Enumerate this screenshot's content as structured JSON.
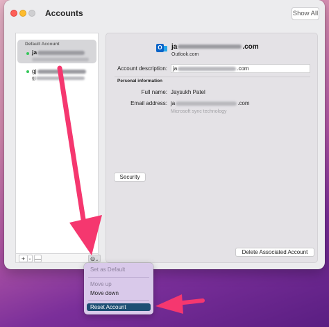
{
  "window": {
    "title": "Accounts",
    "show_all_label": "Show All"
  },
  "sidebar": {
    "accounts": [
      {
        "group_label": "Default Account",
        "email_prefix": "ja",
        "selected": true,
        "status": "online"
      },
      {
        "email_prefix": "gj",
        "sub_prefix": "gj",
        "selected": false,
        "status": "online"
      }
    ],
    "add_label": "+",
    "remove_label": "—",
    "actions_label": "⊝"
  },
  "detail": {
    "account_title_prefix": "ja",
    "account_title_suffix": ".com",
    "account_type": "Outlook.com",
    "description_label": "Account description:",
    "description_prefix": "ja",
    "description_suffix": ".com",
    "section_title": "Personal information",
    "full_name_label": "Full name:",
    "full_name_value": "Jaysukh Patel",
    "email_label": "Email address:",
    "email_prefix": "ja",
    "email_suffix": ".com",
    "sync_hint": "Microsoft sync technology",
    "security_button": "Security",
    "delete_button": "Delete Associated Account"
  },
  "menu": {
    "items": [
      {
        "label": "Set as Default",
        "enabled": false
      },
      {
        "label": "Move up",
        "enabled": false
      },
      {
        "label": "Move down",
        "enabled": true
      },
      {
        "label": "Reset Account",
        "enabled": true,
        "highlighted": true
      }
    ]
  },
  "colors": {
    "arrow": "#f5376f",
    "menu_highlight": "#1d4f74",
    "traffic_red": "#fe5f57",
    "traffic_yellow": "#febc2e",
    "status_online": "#34c759",
    "outlook_blue": "#0a64c8"
  }
}
